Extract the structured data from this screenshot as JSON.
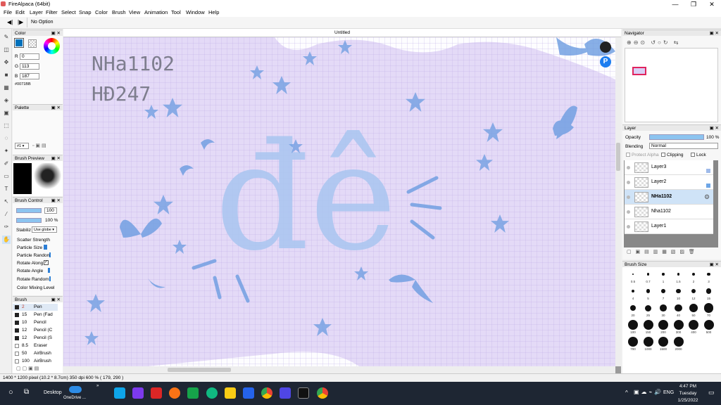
{
  "window": {
    "title": "FireAlpaca (64bit)",
    "min": "—",
    "max": "❐",
    "close": "✕"
  },
  "menu": [
    "File",
    "Edit",
    "Layer",
    "Filter",
    "Select",
    "Snap",
    "Color",
    "Brush",
    "View",
    "Animation",
    "Tool",
    "Window",
    "Help"
  ],
  "toolbar": {
    "option_label": "No Option"
  },
  "color_panel": {
    "title": "Color",
    "r_label": "R",
    "r": "0",
    "g_label": "G",
    "g": "113",
    "b_label": "B",
    "b": "187",
    "hex": "#0071BB",
    "accent": "#0071BB"
  },
  "palette_panel": {
    "title": "Palette",
    "selector": "#1 ▾"
  },
  "brush_preview": {
    "title": "Brush Preview"
  },
  "brush_control": {
    "title": "Brush Control",
    "size_value": "100",
    "opacity_value": "100 %",
    "stabilizer_label": "Stabiliz",
    "stabilizer_value": "Use globe ▾",
    "options": [
      "Scatter Strength",
      "Particle Size",
      "Particle Random",
      "Rotate Along",
      "Rotate Angle",
      "Rotate Random",
      "Color Mixing Level"
    ]
  },
  "brush_panel": {
    "title": "Brush",
    "items": [
      {
        "size": "2",
        "name": "Pen",
        "selected": true
      },
      {
        "size": "15",
        "name": "Pen (Fad"
      },
      {
        "size": "10",
        "name": "Pencil"
      },
      {
        "size": "12",
        "name": "Pencil (C"
      },
      {
        "size": "12",
        "name": "Pencil (S"
      },
      {
        "size": "8.5",
        "name": "Eraser"
      },
      {
        "size": "50",
        "name": "AirBrush"
      },
      {
        "size": "100",
        "name": "AirBrush"
      }
    ]
  },
  "canvas": {
    "tab_title": "Untitled",
    "watermark_line1": "NHa1102",
    "watermark_line2": "HĐ247",
    "center_text": "đê",
    "bg_color": "#e4daf7",
    "art_color": "#6b9be0"
  },
  "navigator": {
    "title": "Navigator"
  },
  "layer_panel": {
    "title": "Layer",
    "opacity_label": "Opacity",
    "opacity_value": "100 %",
    "blending_label": "Blending",
    "blending_value": "Normal",
    "protect_alpha": "Protect Alpha",
    "clipping": "Clipping",
    "lock": "Lock",
    "layers": [
      {
        "name": "Layer3",
        "selected": false
      },
      {
        "name": "Layer2",
        "selected": false
      },
      {
        "name": "NHa1102",
        "selected": true
      },
      {
        "name": "Nha1102",
        "selected": false
      },
      {
        "name": "Layer1",
        "selected": false
      }
    ]
  },
  "brush_size_panel": {
    "title": "Brush Size",
    "sizes": [
      "0.5",
      "0.7",
      "1",
      "1.5",
      "2",
      "3",
      "4",
      "5",
      "7",
      "10",
      "12",
      "15",
      "20",
      "25",
      "30",
      "40",
      "50",
      "70",
      "100",
      "150",
      "200",
      "300",
      "400",
      "500",
      "700",
      "1000",
      "1500",
      "2000"
    ]
  },
  "status": {
    "text": "1400 * 1200 pixel  (10.2 * 8.7cm)  350 dpi  600 %  ( 179, 290 )"
  },
  "taskbar": {
    "desktop_label": "Desktop",
    "onedrive_label": "OneDrive ...",
    "lang": "ENG",
    "time": "4:47 PM",
    "day": "Tuesday",
    "date": "1/25/2022"
  }
}
